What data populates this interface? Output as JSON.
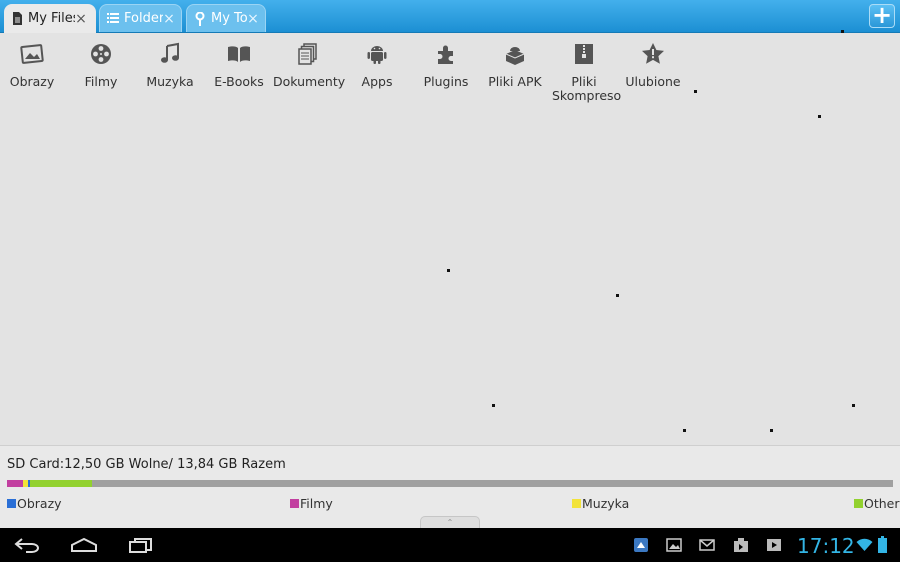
{
  "tabs": [
    {
      "label": "My Files",
      "icon": "document-icon",
      "active": true
    },
    {
      "label": "Folders",
      "icon": "list-icon",
      "active": false
    },
    {
      "label": "My Tools",
      "icon": "wrench-icon",
      "active": false
    }
  ],
  "close_glyph": "×",
  "add_glyph": "+",
  "categories": [
    {
      "label": "Obrazy",
      "icon": "picture-icon"
    },
    {
      "label": "Filmy",
      "icon": "film-reel-icon"
    },
    {
      "label": "Muzyka",
      "icon": "music-note-icon"
    },
    {
      "label": "E-Books",
      "icon": "book-icon"
    },
    {
      "label": "Dokumenty",
      "icon": "documents-icon"
    },
    {
      "label": "Apps",
      "icon": "android-icon"
    },
    {
      "label": "Plugins",
      "icon": "puzzle-icon"
    },
    {
      "label": "Pliki APK",
      "icon": "apk-box-icon"
    },
    {
      "label": "Pliki Skompreso",
      "icon": "archive-icon"
    },
    {
      "label": "Ulubione",
      "icon": "star-icon"
    }
  ],
  "storage": {
    "summary": "SD Card:12,50 GB Wolne/ 13,84 GB Razem",
    "usage_fraction": {
      "obrazy": 0.002,
      "filmy": 0.018,
      "muzyka": 0.006,
      "other": 0.07
    },
    "legend": [
      {
        "label": "Obrazy",
        "color": "#2a6fd6"
      },
      {
        "label": "Filmy",
        "color": "#c23fa0"
      },
      {
        "label": "Muzyka",
        "color": "#f2e33a"
      },
      {
        "label": "Other",
        "color": "#92d12f"
      }
    ],
    "free_color": "#a0a0a0"
  },
  "handle_glyph": "⌃",
  "system_bar": {
    "clock": "17:12",
    "accent": "#33b5e5"
  },
  "colors": {
    "tabbar": "#2a9de0",
    "background": "#e3e3e3"
  }
}
